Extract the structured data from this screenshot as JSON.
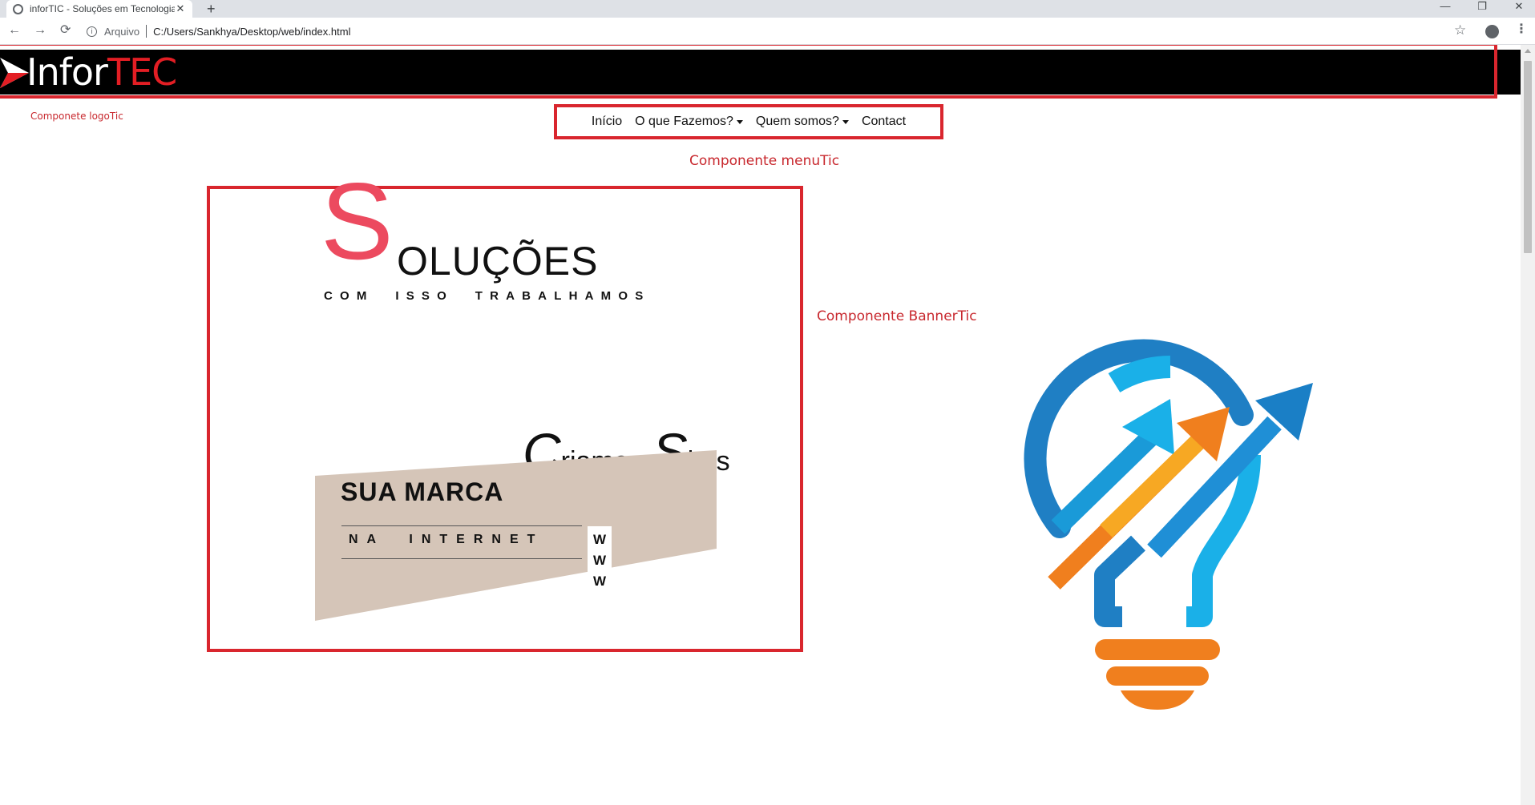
{
  "browser": {
    "tab_title": "inforTIC - Soluções em Tecnologia",
    "tab_close": "✕",
    "new_tab": "+",
    "address_scheme": "Arquivo",
    "address_path": "C:/Users/Sankhya/Desktop/web/index.html",
    "controls": {
      "back": "←",
      "forward": "→",
      "reload": "⟳",
      "minimize": "—",
      "restore": "❐",
      "close": "✕",
      "star": "☆",
      "menu": "⋮"
    }
  },
  "logo": {
    "part1": "Infor",
    "part2": "TEC",
    "colors": {
      "text": "#ffffff",
      "accent": "#e31e24"
    }
  },
  "menu": {
    "items": [
      {
        "label": "Início",
        "dropdown": false
      },
      {
        "label": "O que Fazemos?",
        "dropdown": true
      },
      {
        "label": "Quem somos?",
        "dropdown": true
      },
      {
        "label": "Contact",
        "dropdown": false
      }
    ]
  },
  "annotations": {
    "logo_label": "Componete logoTic",
    "menu_label": "Componente menuTic",
    "banner_label": "Componente BannerTic",
    "color": "#d9262e"
  },
  "banner": {
    "big_letter": "S",
    "heading_rest": "OLUÇÕES",
    "tagline": "COM  ISSO  TRABALHAMOS",
    "criamos_cap": "C",
    "criamos_rest": "riamos",
    "sites_cap": "S",
    "sites_rest": "ites",
    "brand_title": "SUA MARCA",
    "brand_subtitle": "NA  INTERNET",
    "www": [
      "W",
      "W",
      "W"
    ],
    "colors": {
      "accent": "#ec4a5f",
      "panel": "#d5c5b8"
    }
  },
  "icons": {
    "favicon": "globe-icon",
    "bulb": "lightbulb-growth-arrows-icon",
    "colors": {
      "blue": "#1f8fd6",
      "cyan": "#1ab0e8",
      "orange": "#f07f1e",
      "gold": "#f7a823"
    }
  }
}
